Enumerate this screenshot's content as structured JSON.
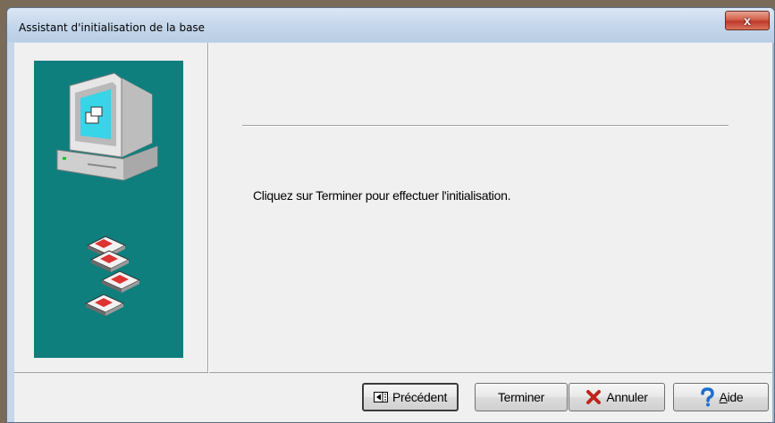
{
  "window": {
    "title": "Assistant d'initialisation de la base",
    "close_glyph": "x"
  },
  "wizard": {
    "message": "Cliquez sur Terminer pour effectuer l'initialisation."
  },
  "buttons": {
    "previous": "Précédent",
    "finish": "Terminer",
    "cancel": "Annuler",
    "help": "Aide"
  },
  "colors": {
    "side_panel": "#0f7f7e",
    "cancel_icon": "#c0241c",
    "help_icon": "#1e6fd0"
  },
  "icons": [
    "computer-icon",
    "floppy-disks-icon",
    "previous-icon",
    "cancel-x-icon",
    "help-question-icon"
  ]
}
